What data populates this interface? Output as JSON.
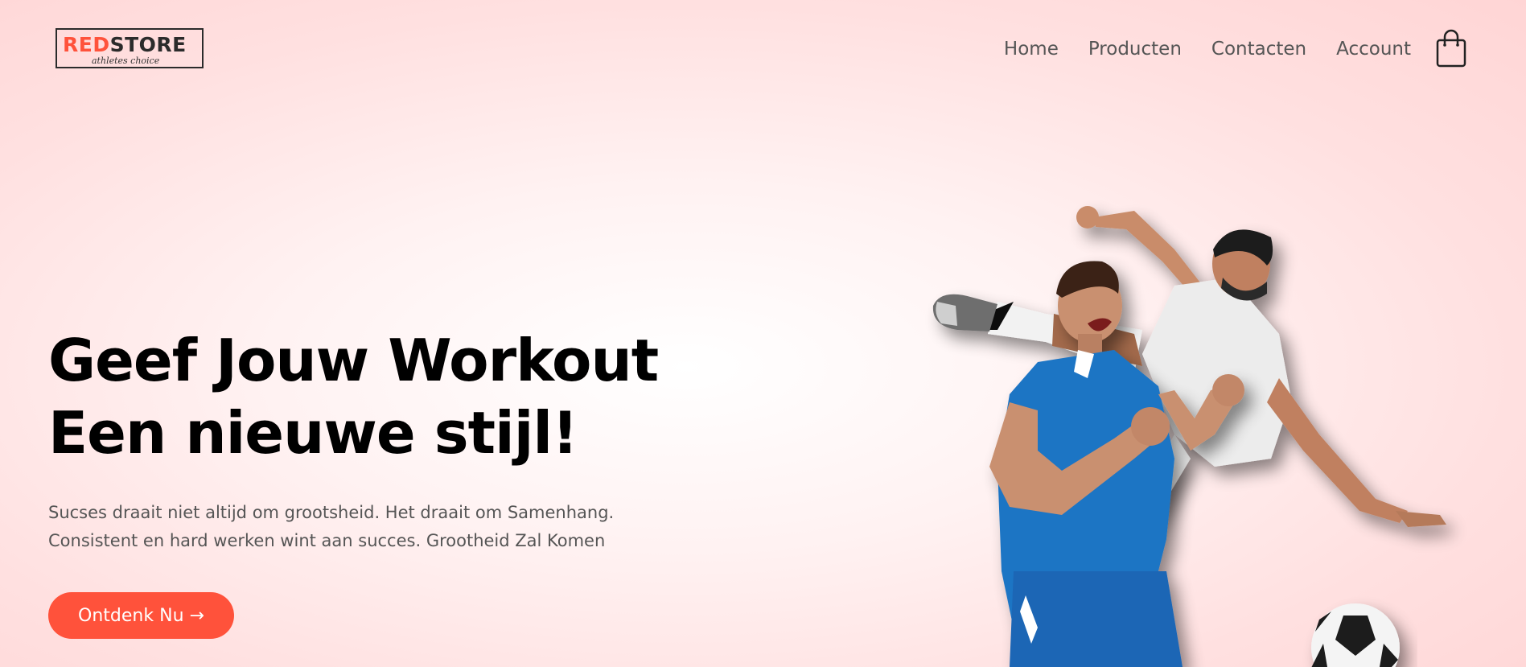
{
  "header": {
    "logo": {
      "word_red": "RED",
      "word_dark": "STORE",
      "tagline": "athletes choice"
    },
    "nav": [
      {
        "label": "Home"
      },
      {
        "label": "Producten"
      },
      {
        "label": "Contacten"
      },
      {
        "label": "Account"
      }
    ],
    "cart_icon": "shopping-bag-icon"
  },
  "hero": {
    "headline_line1": "Geef Jouw Workout",
    "headline_line2": "Een nieuwe stijl!",
    "subtitle_line1": "Sucses draait niet altijd om grootsheid. Het draait om Samenhang.",
    "subtitle_line2": "Consistent en hard werken wint aan succes. Grootheid Zal Komen",
    "cta_label": "Ontdenk Nu →",
    "image": "soccer-players-image"
  },
  "colors": {
    "accent": "#ff523b",
    "text_dark": "#000000",
    "text_muted": "#555555",
    "background_pink": "#ffd5d5"
  }
}
